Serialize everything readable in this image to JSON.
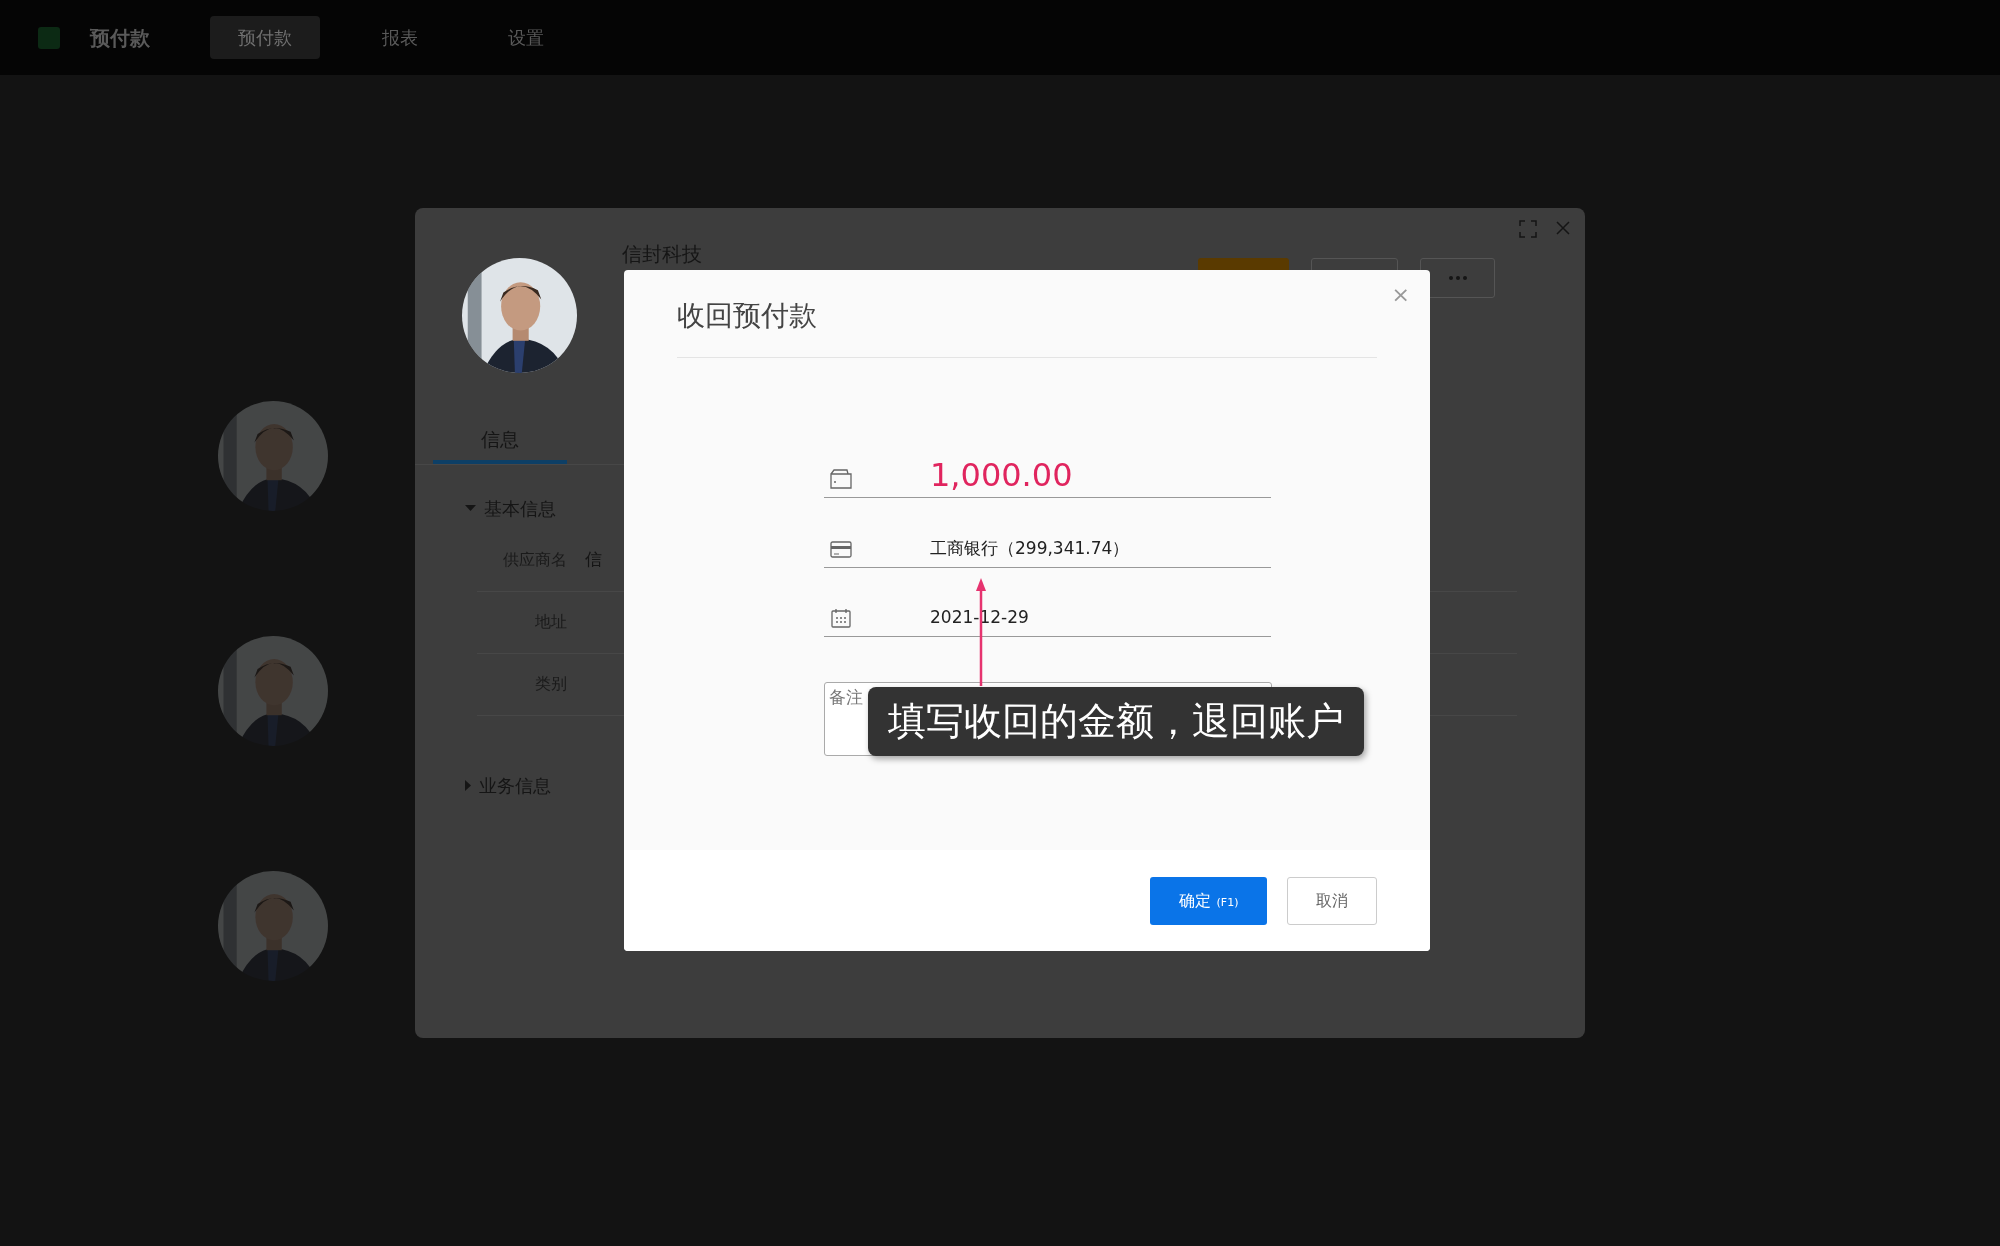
{
  "top_nav": {
    "logo": "预付款",
    "items": [
      {
        "label": "预付款",
        "selected": true
      },
      {
        "label": "报表",
        "selected": false
      },
      {
        "label": "设置",
        "selected": false
      }
    ]
  },
  "detail_panel": {
    "title": "信封科技",
    "tabs": [
      {
        "label": "信息",
        "selected": true
      }
    ],
    "sections": [
      {
        "title": "基本信息",
        "expanded": true,
        "fields": [
          {
            "label": "供应商名",
            "value": "信"
          },
          {
            "label": "地址"
          },
          {
            "label": "类别"
          }
        ]
      },
      {
        "title": "业务信息",
        "expanded": false
      }
    ]
  },
  "dialog": {
    "title": "收回预付款",
    "close": "×",
    "amount": "1,000.00",
    "account": "工商银行（299,341.74）",
    "date": "2021-12-29",
    "remark": {
      "placeholder": "备注"
    },
    "buttons": [
      {
        "label": "确定",
        "shortcut": "(F1)",
        "kind": "primary"
      },
      {
        "label": "取消",
        "kind": "secondary"
      }
    ]
  },
  "annotation": {
    "text": "填写收回的金额，退回账户"
  }
}
